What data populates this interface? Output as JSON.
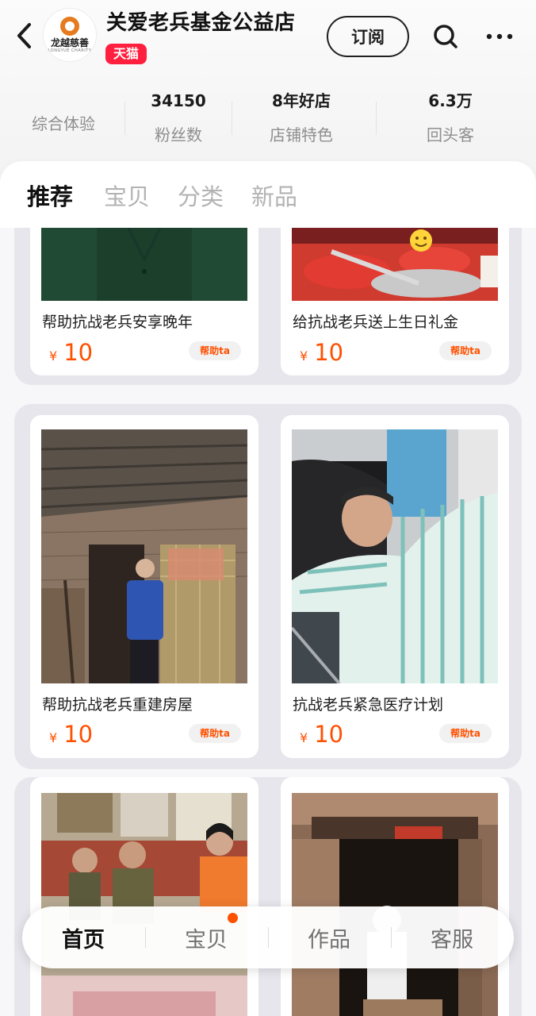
{
  "store": {
    "name": "关爱老兵基金公益店",
    "badge": "天猫",
    "logo_text": "龙越慈善",
    "logo_sub": "LONGYUE CHARITY",
    "subscribe_label": "订阅"
  },
  "stats": {
    "overall_label": "综合体验",
    "items": [
      {
        "value": "34150",
        "label": "粉丝数"
      },
      {
        "value": "8年好店",
        "label": "店铺特色"
      },
      {
        "value": "6.3万",
        "label": "回头客"
      }
    ]
  },
  "tabs": [
    "推荐",
    "宝贝",
    "分类",
    "新品"
  ],
  "products": [
    {
      "title": "帮助抗战老兵安享晚年",
      "currency": "¥",
      "price": "10",
      "action": "帮助ta"
    },
    {
      "title": "给抗战老兵送上生日礼金",
      "currency": "¥",
      "price": "10",
      "action": "帮助ta"
    },
    {
      "title": "帮助抗战老兵重建房屋",
      "currency": "¥",
      "price": "10",
      "action": "帮助ta"
    },
    {
      "title": "抗战老兵紧急医疗计划",
      "currency": "¥",
      "price": "10",
      "action": "帮助ta"
    }
  ],
  "bottom_nav": [
    "首页",
    "宝贝",
    "作品",
    "客服"
  ],
  "colors": {
    "accent": "#ff5000",
    "tmall": "#ff1f3e"
  },
  "icons": {
    "back": "back-arrow-icon",
    "search": "search-icon",
    "more": "more-dots-icon"
  }
}
